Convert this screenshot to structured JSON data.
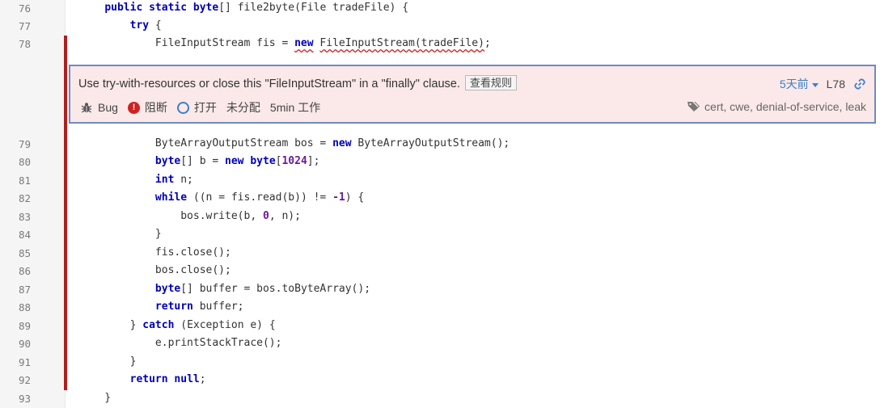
{
  "code_lines": [
    {
      "n": "76",
      "text": "    public static byte[] file2byte(File tradeFile) {"
    },
    {
      "n": "77",
      "text": "        try {"
    },
    {
      "n": "78",
      "text": "            FileInputStream fis = new FileInputStream(tradeFile);"
    },
    {
      "n": "79",
      "text": "            ByteArrayOutputStream bos = new ByteArrayOutputStream();"
    },
    {
      "n": "80",
      "text": "            byte[] b = new byte[1024];"
    },
    {
      "n": "81",
      "text": "            int n;"
    },
    {
      "n": "82",
      "text": "            while ((n = fis.read(b)) != -1) {"
    },
    {
      "n": "83",
      "text": "                bos.write(b, 0, n);"
    },
    {
      "n": "84",
      "text": "            }"
    },
    {
      "n": "85",
      "text": "            fis.close();"
    },
    {
      "n": "86",
      "text": "            bos.close();"
    },
    {
      "n": "87",
      "text": "            byte[] buffer = bos.toByteArray();"
    },
    {
      "n": "88",
      "text": "            return buffer;"
    },
    {
      "n": "89",
      "text": "        } catch (Exception e) {"
    },
    {
      "n": "90",
      "text": "            e.printStackTrace();"
    },
    {
      "n": "91",
      "text": "        }"
    },
    {
      "n": "92",
      "text": "        return null;"
    },
    {
      "n": "93",
      "text": "    }"
    }
  ],
  "issue": {
    "message": "Use try-with-resources or close this \"FileInputStream\" in a \"finally\" clause.",
    "rule_button": "查看规则",
    "type": "Bug",
    "severity": "阻断",
    "status": "打开",
    "assignee": "未分配",
    "effort": "5min 工作",
    "age": "5天前",
    "line_ref": "L78",
    "tags": "cert, cwe, denial-of-service, leak"
  },
  "colors": {
    "issue_bar": "#b01e1e",
    "issue_bg": "#fbe8e8",
    "issue_border": "#6c8bbf",
    "keyword": "#0000b8",
    "number": "#6a1b9a",
    "link": "#3a80c8"
  },
  "icons": {
    "type": "bug-icon",
    "severity": "blocker-icon",
    "status": "open-circle-icon",
    "age_menu": "caret-down-icon",
    "permalink": "link-icon",
    "tags": "tag-icon"
  }
}
